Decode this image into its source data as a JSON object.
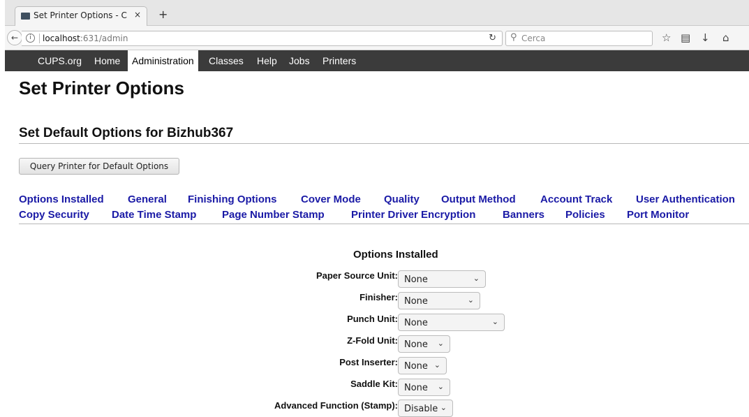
{
  "browser": {
    "tab_title": "Set Printer Options - C",
    "tab_close": "×",
    "new_tab": "+",
    "url_host": "localhost",
    "url_rest": ":631/admin",
    "search_placeholder": "Cerca",
    "icons": [
      "back-icon",
      "info-icon",
      "reload-icon",
      "search-icon",
      "bookmark-star-icon",
      "reading-list-icon",
      "download-icon",
      "home-icon"
    ]
  },
  "nav": {
    "items": [
      "CUPS.org",
      "Home",
      "Administration",
      "Classes",
      "Help",
      "Jobs",
      "Printers"
    ],
    "active": "Administration"
  },
  "page": {
    "title": "Set Printer Options",
    "subtitle": "Set Default Options for Bizhub367",
    "query_button": "Query Printer for Default Options"
  },
  "option_groups": {
    "row1": [
      "Options Installed",
      "General",
      "Finishing Options",
      "Cover Mode",
      "Quality",
      "Output Method",
      "Account Track",
      "User Authentication"
    ],
    "row2": [
      "Copy Security",
      "Date Time Stamp",
      "Page Number Stamp",
      "Printer Driver Encryption",
      "Banners",
      "Policies",
      "Port Monitor"
    ]
  },
  "installed": {
    "heading": "Options Installed",
    "options": [
      {
        "label": "Paper Source Unit:",
        "value": "None"
      },
      {
        "label": "Finisher:",
        "value": "None"
      },
      {
        "label": "Punch Unit:",
        "value": "None"
      },
      {
        "label": "Z-Fold Unit:",
        "value": "None"
      },
      {
        "label": "Post Inserter:",
        "value": "None"
      },
      {
        "label": "Saddle Kit:",
        "value": "None"
      },
      {
        "label": "Advanced Function (Stamp):",
        "value": "Disable"
      }
    ]
  }
}
